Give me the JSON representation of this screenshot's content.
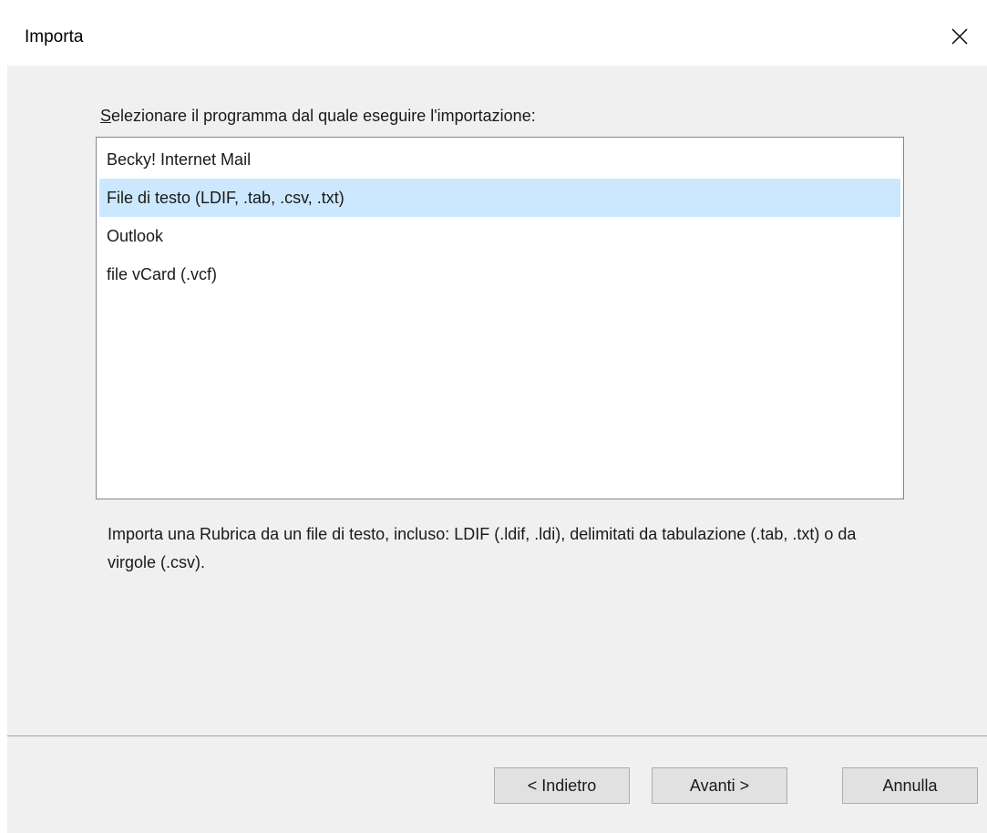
{
  "window": {
    "title": "Importa",
    "close_icon": "close-icon"
  },
  "prompt": {
    "accel_letter": "S",
    "rest": "elezionare il programma dal quale eseguire l'importazione:"
  },
  "programs": {
    "items": [
      {
        "label": "Becky! Internet Mail",
        "selected": false
      },
      {
        "label": "File di testo (LDIF, .tab, .csv, .txt)",
        "selected": true
      },
      {
        "label": "Outlook",
        "selected": false
      },
      {
        "label": "file vCard (.vcf)",
        "selected": false
      }
    ]
  },
  "description": {
    "text": "Importa una Rubrica da un file di testo, incluso: LDIF (.ldif, .ldi), delimitati da tabulazione (.tab, .txt) o da virgole (.csv)."
  },
  "buttons": {
    "back": "< Indietro",
    "next": "Avanti >",
    "cancel": "Annulla"
  },
  "colors": {
    "selection": "#cce8ff",
    "dialog_bg": "#f0f0f0"
  }
}
